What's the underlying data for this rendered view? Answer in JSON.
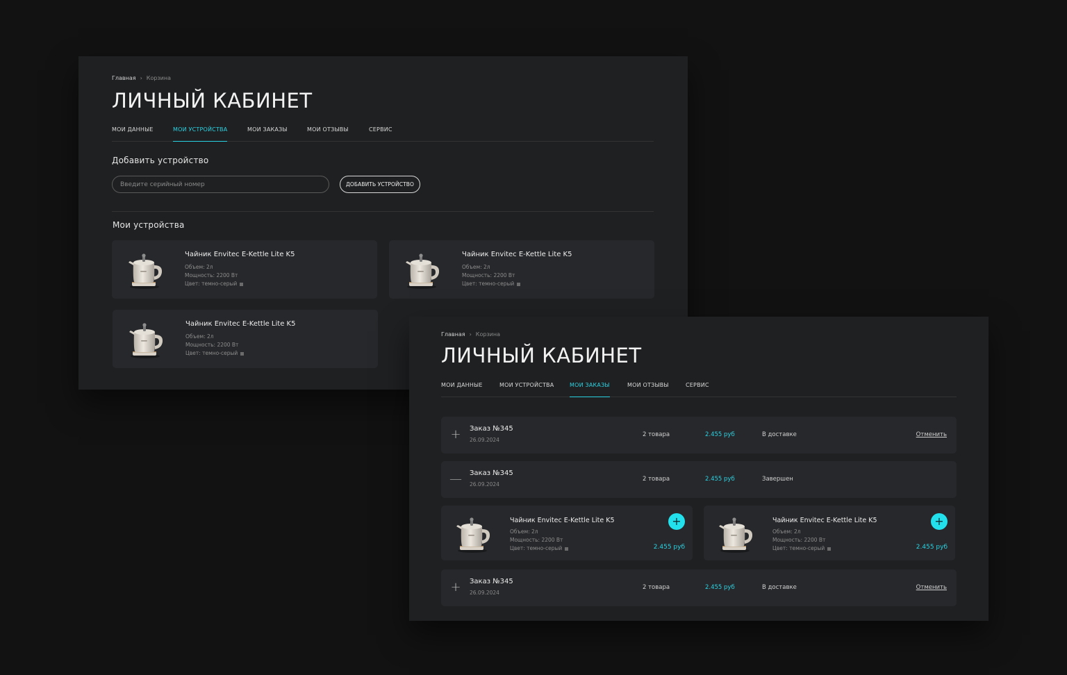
{
  "accent_color": "#2ad3e3",
  "devices_page": {
    "breadcrumb": {
      "home": "Главная",
      "current": "Корзина",
      "separator": "›"
    },
    "title": "ЛИЧНЫЙ КАБИНЕТ",
    "tabs": [
      "МОИ ДАННЫЕ",
      "МОИ УСТРОЙСТВА",
      "МОИ ЗАКАЗЫ",
      "МОИ ОТЗЫВЫ",
      "СЕРВИС"
    ],
    "active_tab": "МОИ УСТРОЙСТВА",
    "add_section_title": "Добавить устройство",
    "serial_placeholder": "Введите серийный номер",
    "add_button": "ДОБАВИТЬ УСТРОЙСТВО",
    "devices_title": "Мои устройства",
    "devices": [
      {
        "name": "Чайник Envitec E-Kettle Lite K5",
        "volume": "Объем: 2л",
        "power": "Мощность: 2200 Вт",
        "color": "Цвет: темно-серый"
      },
      {
        "name": "Чайник Envitec E-Kettle Lite K5",
        "volume": "Объем: 2л",
        "power": "Мощность: 2200 Вт",
        "color": "Цвет: темно-серый"
      },
      {
        "name": "Чайник Envitec E-Kettle Lite K5",
        "volume": "Объем: 2л",
        "power": "Мощность: 2200 Вт",
        "color": "Цвет: темно-серый"
      }
    ]
  },
  "orders_page": {
    "breadcrumb": {
      "home": "Главная",
      "current": "Корзина",
      "separator": "›"
    },
    "title": "ЛИЧНЫЙ КАБИНЕТ",
    "tabs": [
      "МОИ ДАННЫЕ",
      "МОИ УСТРОЙСТВА",
      "МОИ ЗАКАЗЫ",
      "МОИ ОТЗЫВЫ",
      "СЕРВИС"
    ],
    "active_tab": "МОИ ЗАКАЗЫ",
    "orders": [
      {
        "title": "Заказ №345",
        "date": "26.09.2024",
        "count": "2 товара",
        "price": "2.455 руб",
        "status": "В доставке",
        "cancel": "Отменить",
        "toggle": "+"
      },
      {
        "title": "Заказ №345",
        "date": "26.09.2024",
        "count": "2 товара",
        "price": "2.455 руб",
        "status": "Завершен",
        "toggle": "—"
      },
      {
        "title": "Заказ №345",
        "date": "26.09.2024",
        "count": "2 товара",
        "price": "2.455 руб",
        "status": "В доставке",
        "cancel": "Отменить",
        "toggle": "+"
      }
    ],
    "order_items": [
      {
        "name": "Чайник Envitec E-Kettle Lite K5",
        "volume": "Объем: 2л",
        "power": "Мощность: 2200 Вт",
        "color": "Цвет: темно-серый",
        "price": "2.455 руб",
        "action": "+"
      },
      {
        "name": "Чайник Envitec E-Kettle Lite K5",
        "volume": "Объем: 2л",
        "power": "Мощность: 2200 Вт",
        "color": "Цвет: темно-серый",
        "price": "2.455 руб",
        "action": "+"
      }
    ]
  }
}
